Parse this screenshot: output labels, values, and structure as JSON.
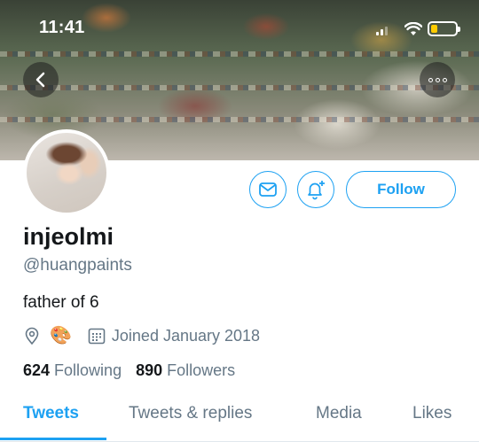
{
  "status_bar": {
    "time": "11:41"
  },
  "banner": {
    "icons": {
      "back": "chevron-left-icon",
      "more": "more-horizontal-icon"
    }
  },
  "profile": {
    "display_name": "injeolmi",
    "handle": "@huangpaints",
    "bio": "father of 6",
    "location_emoji": "🎨",
    "joined": "Joined January 2018",
    "following_count": "624",
    "following_label": "Following",
    "followers_count": "890",
    "followers_label": "Followers"
  },
  "actions": {
    "follow_label": "Follow",
    "icons": {
      "message": "mail-icon",
      "notifications": "bell-plus-icon"
    }
  },
  "tabs": [
    {
      "label": "Tweets",
      "active": true
    },
    {
      "label": "Tweets & replies",
      "active": false
    },
    {
      "label": "Media",
      "active": false
    },
    {
      "label": "Likes",
      "active": false
    }
  ],
  "colors": {
    "accent": "#1da1f2",
    "secondary_text": "#657786",
    "primary_text": "#14171a"
  }
}
